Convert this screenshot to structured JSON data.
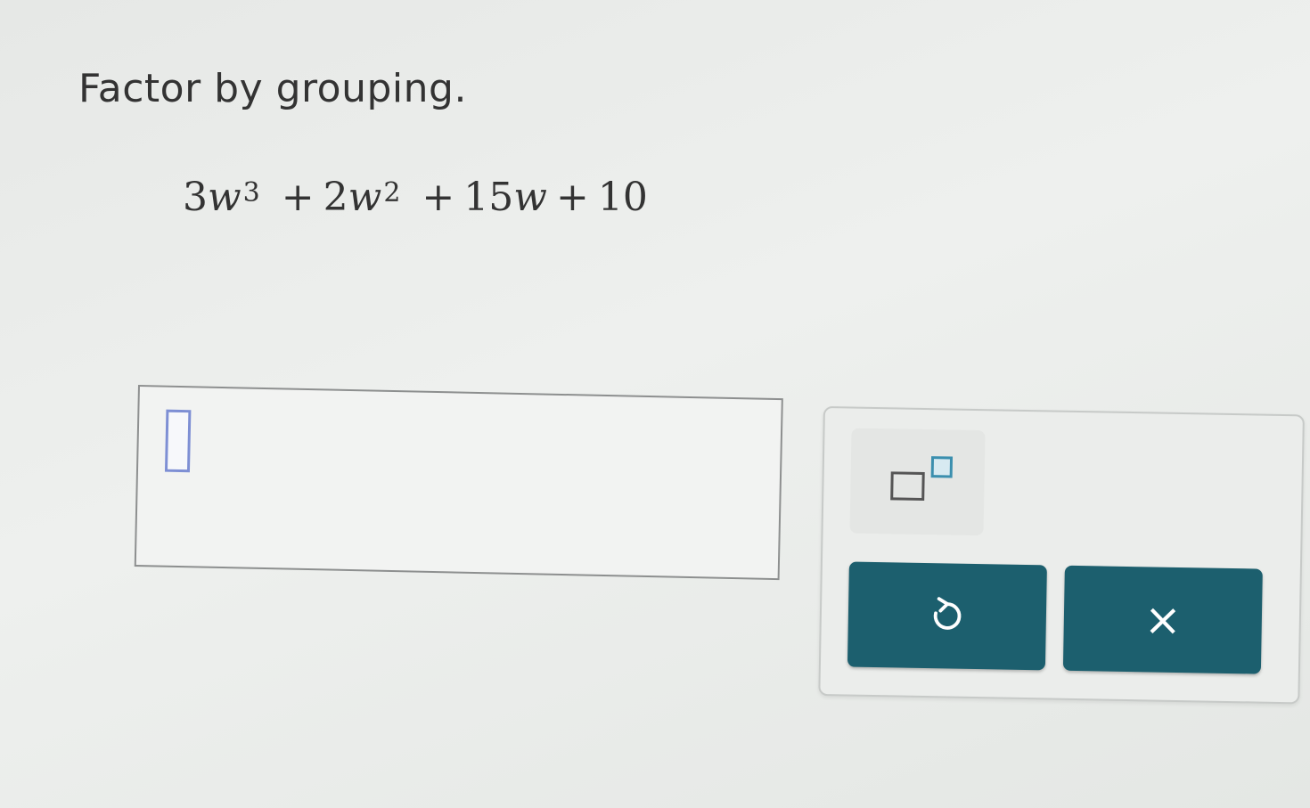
{
  "problem": {
    "instruction": "Factor by grouping.",
    "expression": {
      "term1_coef": "3",
      "term1_var": "w",
      "term1_exp": "3",
      "op1": "+",
      "term2_coef": "2",
      "term2_var": "w",
      "term2_exp": "2",
      "op2": "+",
      "term3_coef": "15",
      "term3_var": "w",
      "op3": "+",
      "term4": "10"
    }
  },
  "answer": {
    "value": ""
  },
  "keypad": {
    "exponent_icon": "superscript-template-icon",
    "undo_icon": "undo-icon",
    "clear_icon": "close-icon",
    "clear_glyph": "×",
    "accent_color": "#1c5f6e",
    "exponent_accent": "#3b8fae"
  }
}
